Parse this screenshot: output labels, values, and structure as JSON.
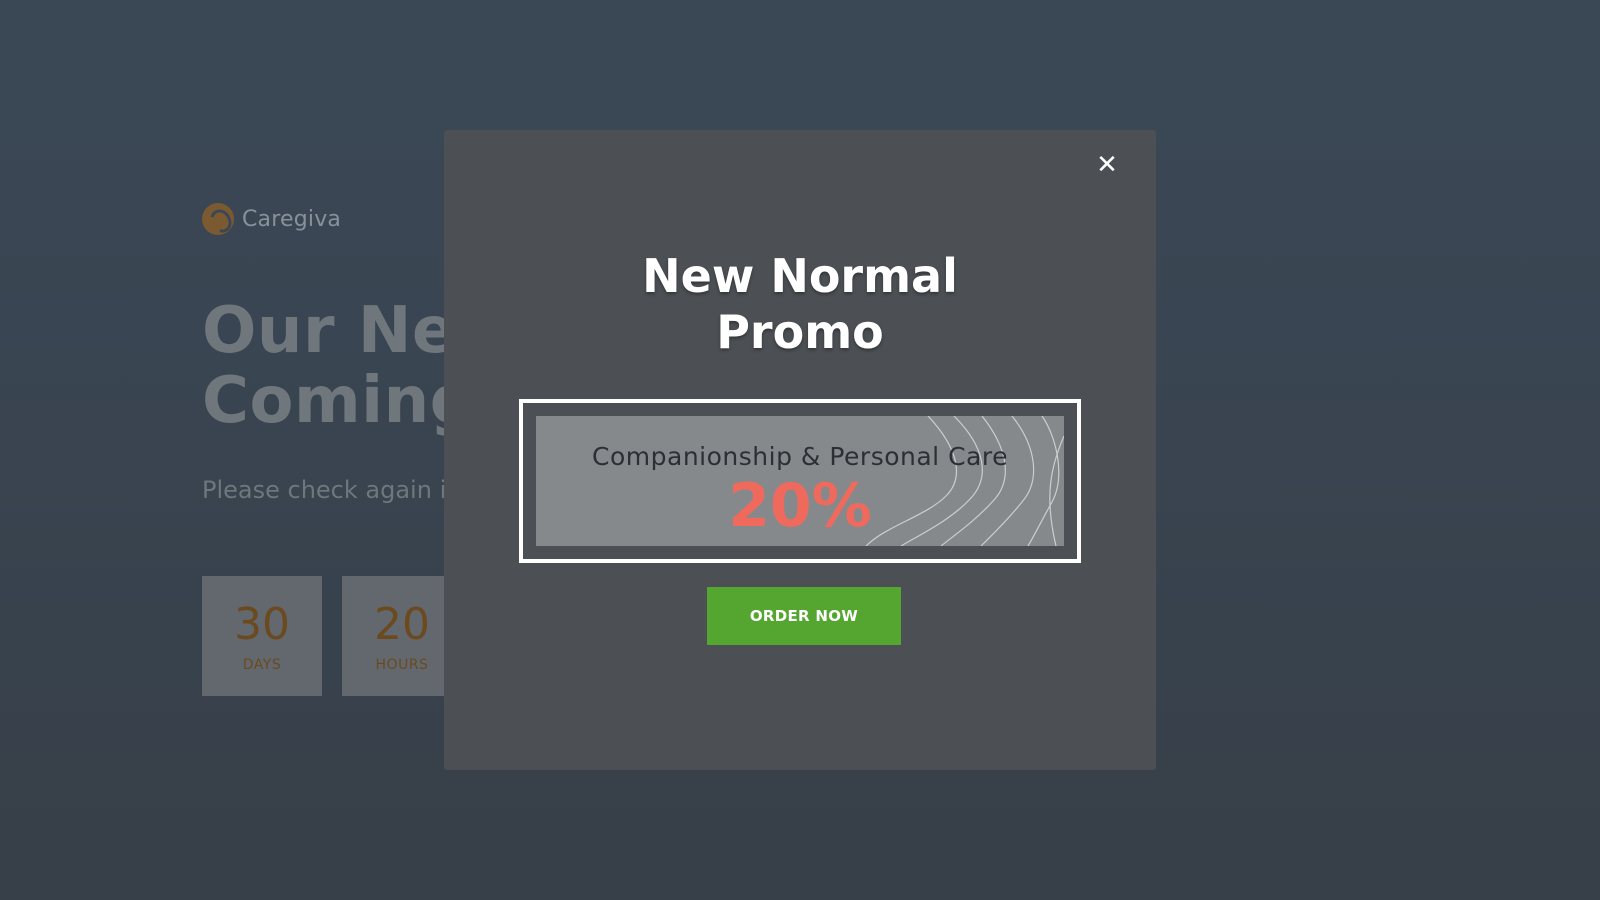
{
  "background": {
    "logo_text": "Caregiva",
    "headline_line1": "Our New",
    "headline_line2": "Coming",
    "subline": "Please check again i",
    "countdown": [
      {
        "value": "30",
        "label": "DAYS"
      },
      {
        "value": "20",
        "label": "HOURS"
      }
    ]
  },
  "modal": {
    "close_symbol": "✕",
    "title_line1": "New Normal",
    "title_line2": "Promo",
    "promo": {
      "subtitle": "Companionship & Personal Care",
      "discount": "20%"
    },
    "cta_label": "ORDER NOW"
  },
  "colors": {
    "modal_bg": "#4c5054",
    "promo_accent": "#ef6a5c",
    "cta_bg": "#55a630",
    "countdown_text": "#6b4a1f"
  },
  "icons": {
    "close": "close-icon",
    "logo": "caregiva-logo-icon",
    "decoration": "wave-lines-icon"
  }
}
